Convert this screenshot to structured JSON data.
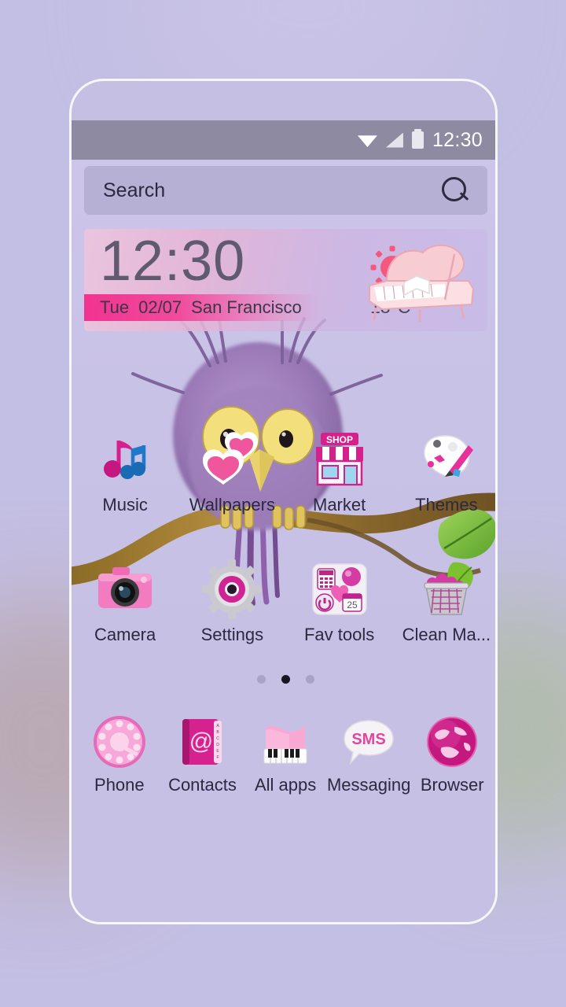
{
  "status_bar": {
    "wifi_icon": "wifi-icon",
    "signal_icon": "signal-icon",
    "battery_icon": "battery-icon",
    "time": "12:30"
  },
  "search": {
    "placeholder": "Search",
    "value": "Search",
    "icon": "search-icon"
  },
  "widget": {
    "time": "12:30",
    "day": "Tue",
    "date": "02/07",
    "city": "San Francisco",
    "temperature": "18°C",
    "weather_icon": "sun-icon",
    "decoration": "pink-heart-piano-illustration",
    "accent_color": "#f1338f",
    "sun_color": "#f4587f"
  },
  "wallpaper": {
    "description": "purple-watercolor-owl-on-branch",
    "background_color": "#c6c0e4",
    "owl_body_color": "#9b7bb4",
    "owl_eye_color": "#f2df7a",
    "branch_color": "#96732f",
    "leaf_color": "#7fc143"
  },
  "home_grid": {
    "rows": [
      {
        "apps": [
          {
            "label": "Music",
            "icon": "music-notes-icon"
          },
          {
            "label": "Wallpapers",
            "icon": "hearts-icon"
          },
          {
            "label": "Market",
            "icon": "shop-storefront-icon"
          },
          {
            "label": "Themes",
            "icon": "palette-brush-icon"
          }
        ]
      },
      {
        "apps": [
          {
            "label": "Camera",
            "icon": "camera-icon"
          },
          {
            "label": "Settings",
            "icon": "gear-icon"
          },
          {
            "label": "Fav tools",
            "icon": "folder-tools-icon",
            "badge": "25"
          },
          {
            "label": "Clean Ma...",
            "icon": "trash-bin-icon"
          }
        ]
      }
    ]
  },
  "page_indicator": {
    "total": 3,
    "active_index": 1
  },
  "dock": {
    "apps": [
      {
        "label": "Phone",
        "icon": "rotary-dial-icon"
      },
      {
        "label": "Contacts",
        "icon": "address-book-icon"
      },
      {
        "label": "All apps",
        "icon": "piano-icon"
      },
      {
        "label": "Messaging",
        "icon": "sms-bubble-icon"
      },
      {
        "label": "Browser",
        "icon": "globe-icon"
      }
    ]
  },
  "colors": {
    "status_bar": "#8d8aa2",
    "screen_bg": "#c6c0e4",
    "search_bg": "#ada8cc",
    "text": "#2c2840",
    "pink": "#e8339a",
    "magenta": "#c4218c"
  }
}
